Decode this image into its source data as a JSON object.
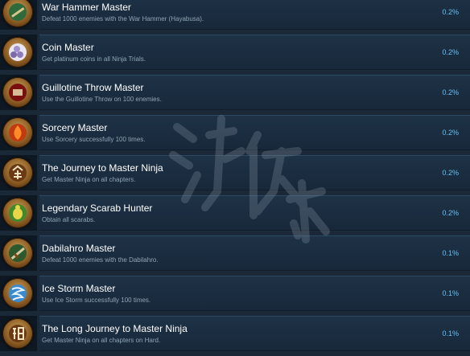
{
  "achievements": [
    {
      "name": "War Hammer Master",
      "description": "Defeat 1000 enemies with the War Hammer (Hayabusa).",
      "percent": "0.2%",
      "icon": "war-hammer-icon",
      "color": "#2f6b3a"
    },
    {
      "name": "Coin Master",
      "description": "Get platinum coins in all Ninja Trials.",
      "percent": "0.2%",
      "icon": "platinum-coins-icon",
      "color": "#d8d8ee"
    },
    {
      "name": "Guillotine Throw Master",
      "description": "Use the Guillotine Throw on 100 enemies.",
      "percent": "0.2%",
      "icon": "guillotine-throw-icon",
      "color": "#7a0f0f"
    },
    {
      "name": "Sorcery Master",
      "description": "Use Sorcery successfully 100 times.",
      "percent": "0.2%",
      "icon": "sorcery-flame-icon",
      "color": "#c23a10"
    },
    {
      "name": "The Journey to Master Ninja",
      "description": "Get Master Ninja on all chapters.",
      "percent": "0.2%",
      "icon": "master-ninja-kanji-icon",
      "color": "#6a3a14"
    },
    {
      "name": "Legendary Scarab Hunter",
      "description": "Obtain all scarabs.",
      "percent": "0.2%",
      "icon": "scarab-icon",
      "color": "#3f8a2a"
    },
    {
      "name": "Dabilahro Master",
      "description": "Defeat 1000 enemies with the Dabilahro.",
      "percent": "0.1%",
      "icon": "dabilahro-sword-icon",
      "color": "#2c5a2c"
    },
    {
      "name": "Ice Storm Master",
      "description": "Use Ice Storm successfully 100 times.",
      "percent": "0.1%",
      "icon": "ice-storm-icon",
      "color": "#3a8ad0"
    },
    {
      "name": "The Long Journey to Master Ninja",
      "description": "Get Master Ninja on all chapters on Hard.",
      "percent": "0.1%",
      "icon": "master-ninja-hard-kanji-icon",
      "color": "#6a3a14"
    }
  ]
}
